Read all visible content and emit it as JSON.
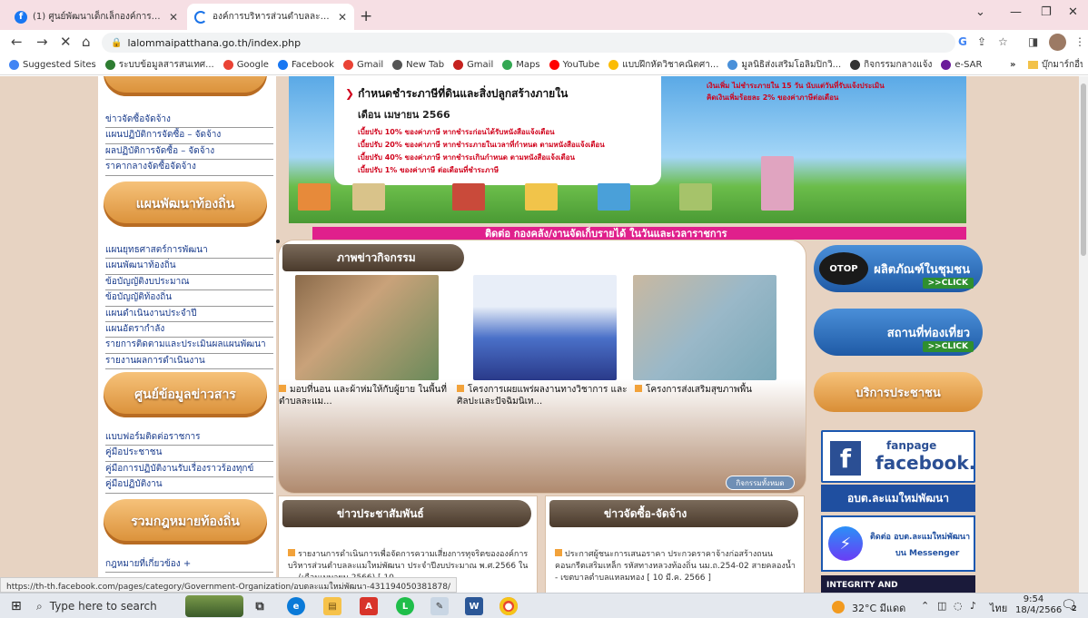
{
  "browser": {
    "tabs": [
      {
        "title": "(1) ศูนย์พัฒนาเด็กเล็กองค์การบริหาร",
        "active": false
      },
      {
        "title": "องค์การบริหารส่วนตำบลละแมใหม่พัฒนา",
        "active": true
      }
    ],
    "new_tab": "+",
    "url": "lalommaipatthana.go.th/index.php",
    "bookmarks": [
      {
        "label": "Suggested Sites",
        "color": "#4285f4"
      },
      {
        "label": "ระบบข้อมูลสารสนเทศ...",
        "color": "#2e7d32"
      },
      {
        "label": "Google",
        "color": "#ea4335"
      },
      {
        "label": "Facebook",
        "color": "#1877f2"
      },
      {
        "label": "Gmail",
        "color": "#ea4335"
      },
      {
        "label": "New Tab",
        "color": "#555555"
      },
      {
        "label": "Gmail",
        "color": "#c5221f"
      },
      {
        "label": "Maps",
        "color": "#34a853"
      },
      {
        "label": "YouTube",
        "color": "#ff0000"
      },
      {
        "label": "แบบฝึกหัดวิชาคณิตศา...",
        "color": "#fbbc04"
      },
      {
        "label": "มูลนิธิส่งเสริมโอลิมปิกวิ...",
        "color": "#4a90d9"
      },
      {
        "label": "กิจกรรมกลางแจ้ง",
        "color": "#333333"
      },
      {
        "label": "e-SAR",
        "color": "#6a1b9a"
      }
    ],
    "bookmarks_overflow": "»",
    "other_bookmarks": "บุ๊กมาร์กอื่นๆ"
  },
  "sidebar": {
    "procurement_items": [
      "ข่าวจัดซื้อจัดจ้าง",
      "แผนปฏิบัติการจัดซื้อ – จัดจ้าง",
      "ผลปฏิบัติการจัดซื้อ – จัดจ้าง",
      "ราคากลางจัดซื้อจัดจ้าง"
    ],
    "local_plan_title": "แผนพัฒนาท้องถิ่น",
    "local_plan_items": [
      "แผนยุทธศาสตร์การพัฒนา",
      "แผนพัฒนาท้องถิ่น",
      "ข้อบัญญัติงบประมาณ",
      "ข้อบัญญัติท้องถิ่น",
      "แผนดำเนินงานประจำปี",
      "แผนอัตรากำลัง",
      "รายการติดตามและประเมินผลแผนพัฒนา",
      "รายงานผลการดำเนินงาน"
    ],
    "info_center_title": "ศูนย์ข้อมูลข่าวสาร",
    "info_center_items": [
      "แบบฟอร์มติดต่อราชการ",
      "คู่มือประชาชน",
      "คู่มือการปฏิบัติงานรับเรื่องราวร้องทุกข์",
      "คู่มือปฏิบัติงาน"
    ],
    "law_title": "รวมกฎหมายท้องถิ่น",
    "law_items": [
      "กฎหมายที่เกี่ยวข้อง +"
    ]
  },
  "banner": {
    "title": "กำหนดชำระภาษีที่ดินและสิ่งปลูกสร้างภายใน",
    "subtitle": "เดือน เมษายน 2566",
    "lines": [
      "เบี้ยปรับ 10% ของค่าภาษี หากชำระก่อนได้รับหนังสือแจ้งเตือน",
      "เบี้ยปรับ 20% ของค่าภาษี หากชำระภายในเวลาที่กำหนด ตามหนังสือแจ้งเตือน",
      "เบี้ยปรับ 40% ของค่าภาษี หากชำระเกินกำหนด ตามหนังสือแจ้งเตือน",
      "เบี้ยปรับ 1% ของค่าภาษี ต่อเดือนที่ชำระภาษี"
    ],
    "right_lines": [
      "เงินเพิ่ม ไม่ชำระภายใน 15 วัน นับแต่วันที่รับแจ้งประเมิน",
      "คิดเงินเพิ่มร้อยละ 2% ของค่าภาษีต่อเดือน"
    ],
    "ticker": "ติดต่อ กองคลัง/งานจัดเก็บรายได้ ในวันและเวลาราชการ"
  },
  "activity": {
    "title": "ภาพข่าวกิจกรรม",
    "items": [
      {
        "caption": "มอบที่นอน และผ้าห่มให้กับผู้ยาย ในพื้นที่ตำบลละแม..."
      },
      {
        "caption": "โครงการเผยแพร่ผลงานทางวิชาการ และศิลปะและปัจฉิมนิเท..."
      },
      {
        "caption": "โครงการส่งเสริมสุขภาพพื้น"
      }
    ],
    "all_button": "กิจกรรมทั้งหมด"
  },
  "news": {
    "pr_title": "ข่าวประชาสัมพันธ์",
    "pr_item": "รายงานการดำเนินการเพื่อจัดการความเสี่ยงการทุจริตขององค์การบริหารส่วนตำบลละแมใหม่พัฒนา ประจำปีงบประมาณ พ.ศ.2566 ใน ... (เดือนเมษายน 2566) [ 10",
    "proc_title": "ข่าวจัดซื้อ-จัดจ้าง",
    "proc_item": "ประกาศผู้ชนะการเสนอราคา ประกวดราคาจ้างก่อสร้างถนนคอนกรีตเสริมเหล็ก รหัสทางหลวงท้องถิ่น นม.ถ.254-02 สายคลองน้ำ - เขตบาลตำบลแหลมทอง [ 10 มี.ค. 2566 ]"
  },
  "rightcol": {
    "otop_badge": "OTOP",
    "otop_label": "ผลิตภัณฑ์ในชุมชน",
    "tour_label": "สถานที่ท่องเที่ยว",
    "click_label": ">>CLICK",
    "service_title": "บริการประชาชน",
    "fb_line1": "fanpage",
    "fb_line2": "facebook.",
    "org_name": "อบต.ละแมใหม่พัฒนา",
    "msg_line1": "ติดต่อ อบต.ละแมใหม่พัฒนา",
    "msg_line2": "บน Messenger",
    "integrity_line": "INTEGRITY AND"
  },
  "status_url": "https://th-th.facebook.com/pages/category/Government-Organization/อบตละแมใหม่พัฒนา-431194050381878/",
  "taskbar": {
    "search_placeholder": "Type here to search",
    "weather": "32°C มีแดด",
    "language": "ไทย",
    "time": "9:54",
    "date": "18/4/2566",
    "notifications": "2"
  }
}
